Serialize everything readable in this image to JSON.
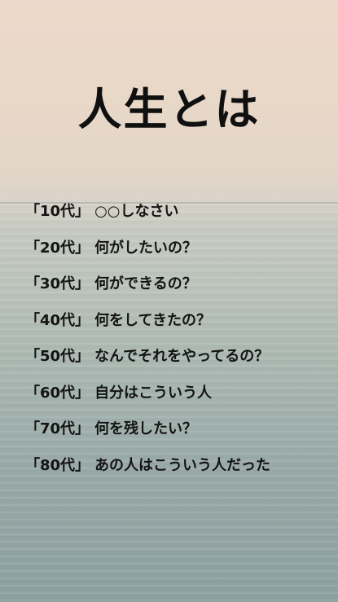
{
  "title": "人生とは",
  "items": [
    {
      "era": "「10代」",
      "text": "○○しなさい"
    },
    {
      "era": "「20代」",
      "text": "何がしたいの？"
    },
    {
      "era": "「30代」",
      "text": "何ができるの？"
    },
    {
      "era": "「40代」",
      "text": "何をしてきたの？"
    },
    {
      "era": "「50代」",
      "text": "なんでそれをやってるの？"
    },
    {
      "era": "「60代」",
      "text": "自分はこういう人"
    },
    {
      "era": "「70代」",
      "text": "何を残したい？"
    },
    {
      "era": "「80代」",
      "text": "あの人はこういう人だった"
    }
  ]
}
